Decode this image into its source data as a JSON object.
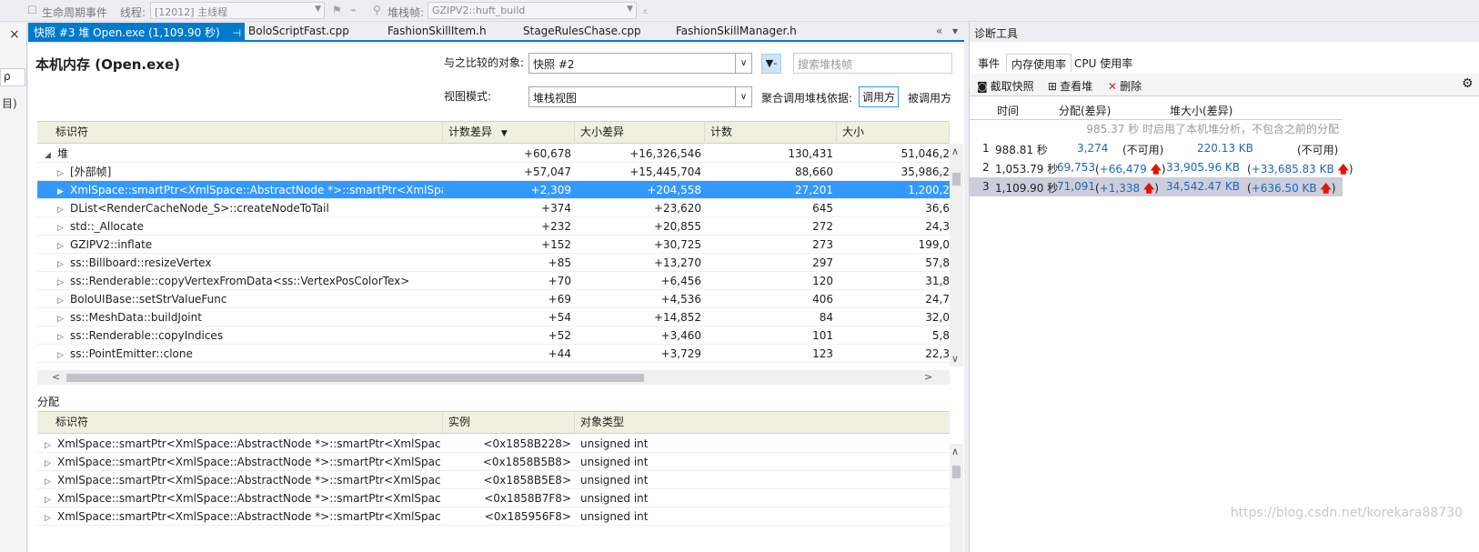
{
  "toolbar": {
    "lifecycle_label": "生命周期事件",
    "thread_label": "线程:",
    "thread_value": "[12012] 主线程",
    "stackframe_label": "堆栈帧:",
    "stackframe_value": "GZIPV2::huft_build"
  },
  "left_strip": {
    "close": "×",
    "search": "ρ",
    "item": "目)"
  },
  "tabs": [
    {
      "label": "快照 #3 堆 Open.exe (1,109.90 秒)",
      "active": true
    },
    {
      "label": "BoloScriptFast.cpp"
    },
    {
      "label": "FashionSkillItem.h"
    },
    {
      "label": "StageRulesChase.cpp"
    },
    {
      "label": "FashionSkillManager.h"
    }
  ],
  "tab_icons": {
    "pin": "⊣",
    "close": "×",
    "overflow": "«",
    "menu": "▾"
  },
  "main": {
    "title": "本机内存 (Open.exe)",
    "compare_label": "与之比较的对象:",
    "compare_value": "快照 #2",
    "search_placeholder": "搜索堆栈帧",
    "view_label": "视图模式:",
    "view_value": "堆栈视图",
    "aggregate_label": "聚合调用堆栈依据:",
    "caller_button": "调用方",
    "callee_button": "被调用方",
    "filter_icon": "filter-icon"
  },
  "heap_grid": {
    "columns": [
      "标识符",
      "计数差异",
      "大小差异",
      "计数",
      "大小"
    ],
    "sort_indicator": "▼",
    "rows": [
      {
        "id": "堆",
        "count_diff": "+60,678",
        "size_diff": "+16,326,546",
        "count": "130,431",
        "size": "51,046,2",
        "expand": "◢",
        "indent": 0
      },
      {
        "id": "[外部帧]",
        "count_diff": "+57,047",
        "size_diff": "+15,445,704",
        "count": "88,660",
        "size": "35,986,2",
        "expand": "▷",
        "indent": 1
      },
      {
        "id": "XmlSpace::smartPtr<XmlSpace::AbstractNode *>::smartPtr<XmlSpace::...",
        "count_diff": "+2,309",
        "size_diff": "+204,558",
        "count": "27,201",
        "size": "1,200,2",
        "expand": "▶",
        "indent": 1,
        "selected": true
      },
      {
        "id": "DList<RenderCacheNode_S>::createNodeToTail",
        "count_diff": "+374",
        "size_diff": "+23,620",
        "count": "645",
        "size": "36,6",
        "expand": "▷",
        "indent": 1
      },
      {
        "id": "std::_Allocate",
        "count_diff": "+232",
        "size_diff": "+20,855",
        "count": "272",
        "size": "24,3",
        "expand": "▷",
        "indent": 1
      },
      {
        "id": "GZIPV2::inflate",
        "count_diff": "+152",
        "size_diff": "+30,725",
        "count": "273",
        "size": "199,0",
        "expand": "▷",
        "indent": 1
      },
      {
        "id": "ss::Billboard::resizeVertex",
        "count_diff": "+85",
        "size_diff": "+13,270",
        "count": "297",
        "size": "57,8",
        "expand": "▷",
        "indent": 1
      },
      {
        "id": "ss::Renderable::copyVertexFromData<ss::VertexPosColorTex>",
        "count_diff": "+70",
        "size_diff": "+6,456",
        "count": "120",
        "size": "31,8",
        "expand": "▷",
        "indent": 1
      },
      {
        "id": "BoloUIBase::setStrValueFunc",
        "count_diff": "+69",
        "size_diff": "+4,536",
        "count": "406",
        "size": "24,7",
        "expand": "▷",
        "indent": 1
      },
      {
        "id": "ss::MeshData::buildJoint",
        "count_diff": "+54",
        "size_diff": "+14,852",
        "count": "84",
        "size": "32,0",
        "expand": "▷",
        "indent": 1
      },
      {
        "id": "ss::Renderable::copyIndices",
        "count_diff": "+52",
        "size_diff": "+3,460",
        "count": "101",
        "size": "5,8",
        "expand": "▷",
        "indent": 1
      },
      {
        "id": "ss::PointEmitter::clone",
        "count_diff": "+44",
        "size_diff": "+3,729",
        "count": "123",
        "size": "22,3",
        "expand": "▷",
        "indent": 1
      }
    ]
  },
  "alloc_section": {
    "title": "分配",
    "columns": [
      "标识符",
      "实例",
      "对象类型"
    ],
    "rows": [
      {
        "id": "XmlSpace::smartPtr<XmlSpace::AbstractNode *>::smartPtr<XmlSpace::Ab...",
        "instance": "<0x1858B228>",
        "type": "unsigned int"
      },
      {
        "id": "XmlSpace::smartPtr<XmlSpace::AbstractNode *>::smartPtr<XmlSpace::Ab...",
        "instance": "<0x1858B5B8>",
        "type": "unsigned int"
      },
      {
        "id": "XmlSpace::smartPtr<XmlSpace::AbstractNode *>::smartPtr<XmlSpace::Ab...",
        "instance": "<0x1858B5E8>",
        "type": "unsigned int"
      },
      {
        "id": "XmlSpace::smartPtr<XmlSpace::AbstractNode *>::smartPtr<XmlSpace::Ab...",
        "instance": "<0x1858B7F8>",
        "type": "unsigned int"
      },
      {
        "id": "XmlSpace::smartPtr<XmlSpace::AbstractNode *>::smartPtr<XmlSpace::Ab...",
        "instance": "<0x185956F8>",
        "type": "unsigned int"
      }
    ]
  },
  "diag": {
    "title": "诊断工具",
    "tabs": [
      "事件",
      "内存使用率",
      "CPU 使用率"
    ],
    "tools": [
      "截取快照",
      "查看堆",
      "删除"
    ],
    "columns": [
      "时间",
      "分配(差异)",
      "堆大小(差异)"
    ],
    "note": "985.37 秒 时启用了本机堆分析，不包含之前的分配",
    "snapshots": [
      {
        "num": "1",
        "time": "988.81 秒",
        "alloc": "3,274",
        "alloc_diff": "(不可用)",
        "heap": "220.13 KB",
        "heap_diff": "(不可用)",
        "up": false
      },
      {
        "num": "2",
        "time": "1,053.79 秒",
        "alloc": "69,753",
        "alloc_diff": "+66,479",
        "heap": "33,905.96 KB",
        "heap_diff": "+33,685.83 KB",
        "up": true
      },
      {
        "num": "3",
        "time": "1,109.90 秒",
        "alloc": "71,091",
        "alloc_diff": "+1,338",
        "heap": "34,542.47 KB",
        "heap_diff": "+636.50 KB",
        "up": true,
        "selected": true
      }
    ]
  },
  "watermark": "https://blog.csdn.net/korekara88730",
  "colors": {
    "accent": "#007acc",
    "selection": "#3399ff",
    "arrow_up": "#e51400",
    "link_blue": "#1d68b8"
  }
}
